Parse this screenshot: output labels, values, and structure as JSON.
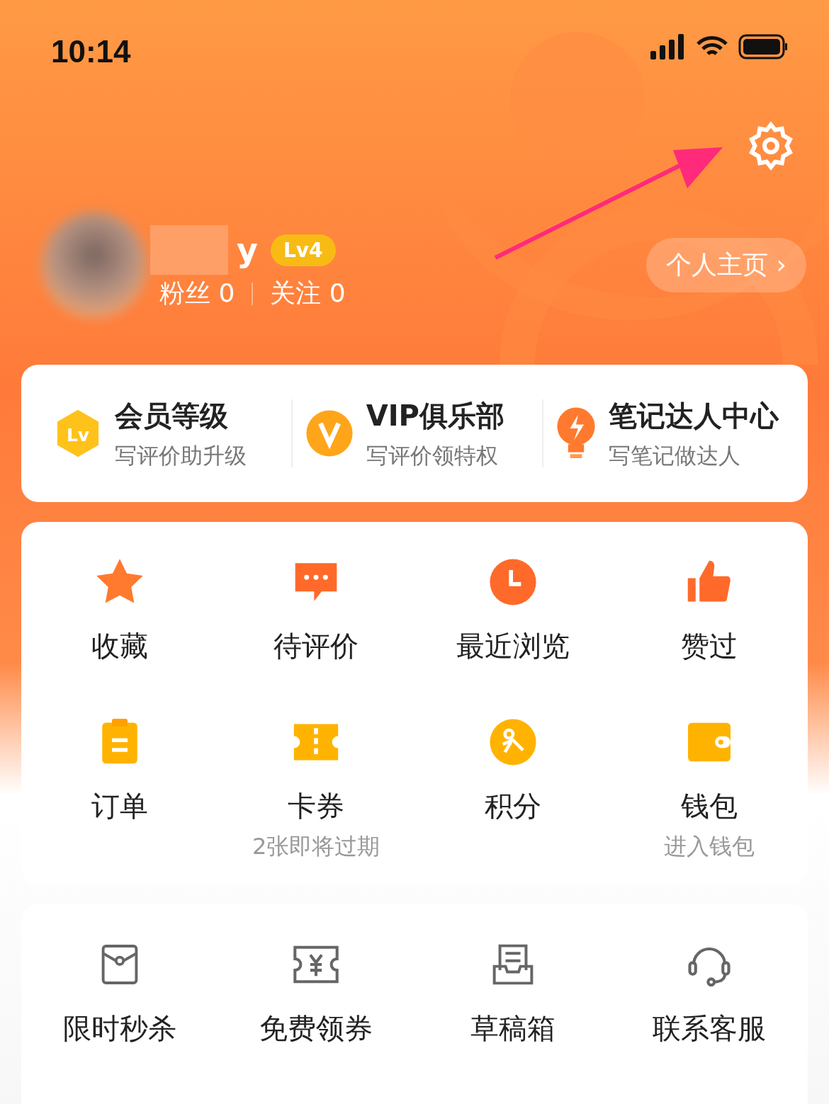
{
  "status_bar": {
    "time": "10:14"
  },
  "profile": {
    "name": "y",
    "level_badge": "Lv4",
    "stats": [
      {
        "label": "粉丝",
        "value": "0"
      },
      {
        "label": "关注",
        "value": "0"
      }
    ],
    "home_button": "个人主页 ›"
  },
  "benefits": [
    {
      "title": "会员等级",
      "subtitle": "写评价助升级",
      "icon_text": "Lv"
    },
    {
      "title": "VIP俱乐部",
      "subtitle": "写评价领特权"
    },
    {
      "title": "笔记达人中心",
      "subtitle": "写笔记做达人"
    }
  ],
  "main_grid": [
    {
      "label": "收藏"
    },
    {
      "label": "待评价"
    },
    {
      "label": "最近浏览"
    },
    {
      "label": "赞过"
    },
    {
      "label": "订单"
    },
    {
      "label": "卡券",
      "note": "2张即将过期"
    },
    {
      "label": "积分"
    },
    {
      "label": "钱包",
      "note": "进入钱包"
    }
  ],
  "tools_grid": [
    {
      "label": "限时秒杀"
    },
    {
      "label": "免费领券"
    },
    {
      "label": "草稿箱"
    },
    {
      "label": "联系客服"
    }
  ]
}
